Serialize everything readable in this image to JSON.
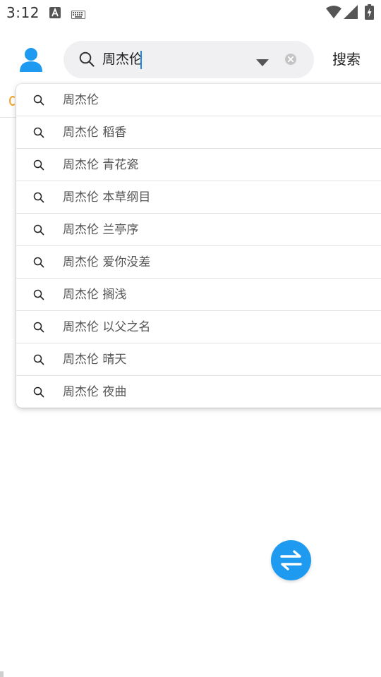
{
  "status_bar": {
    "time": "3:12",
    "icons": [
      "a-notification-icon",
      "keyboard-icon",
      "wifi-icon",
      "signal-icon",
      "battery-charging-icon"
    ]
  },
  "header": {
    "avatar_icon": "user-avatar-icon",
    "search": {
      "value": "周杰伦",
      "search_icon": "search-icon",
      "dropdown_icon": "dropdown-triangle-icon",
      "clear_icon": "clear-circle-icon"
    },
    "search_button_label": "搜索"
  },
  "suggestions": [
    {
      "label": "周杰伦"
    },
    {
      "label": "周杰伦 稻香"
    },
    {
      "label": "周杰伦 青花瓷"
    },
    {
      "label": "周杰伦 本草纲目"
    },
    {
      "label": "周杰伦 兰亭序"
    },
    {
      "label": "周杰伦 爱你没差"
    },
    {
      "label": "周杰伦 搁浅"
    },
    {
      "label": "周杰伦 以父之名"
    },
    {
      "label": "周杰伦 晴天"
    },
    {
      "label": "周杰伦 夜曲"
    }
  ],
  "fab": {
    "icon": "switch-arrows-icon"
  },
  "colors": {
    "accent": "#1e9bf0",
    "search_bg": "#f0f0f3",
    "caret": "#1e88e5",
    "tab_hint": "#f0a428"
  }
}
